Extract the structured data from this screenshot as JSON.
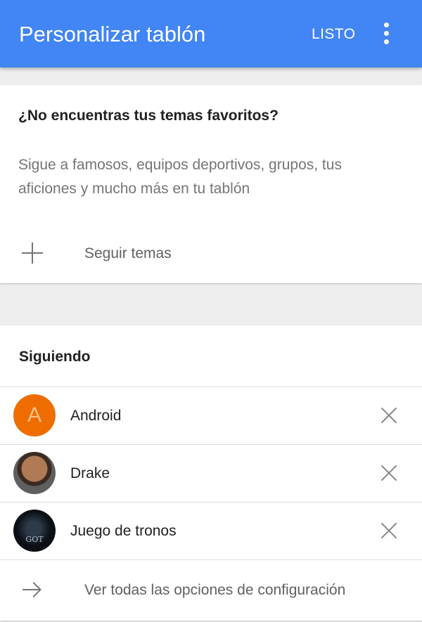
{
  "app_bar": {
    "title": "Personalizar tablón",
    "action_label": "LISTO",
    "background": "#4285f4",
    "overflow_icon": "more-vert-icon"
  },
  "discover_card": {
    "heading": "¿No encuentras tus temas favoritos?",
    "description": "Sigue a famosos, equipos deportivos, grupos, tus aficiones y mucho más en tu tablón",
    "follow_action": {
      "icon": "plus-icon",
      "label": "Seguir temas"
    }
  },
  "following": {
    "title": "Siguiendo",
    "items": [
      {
        "label": "Android",
        "avatar_letter": "A",
        "avatar_color": "#ef6c00",
        "remove_icon": "close-icon"
      },
      {
        "label": "Drake",
        "avatar": "photo",
        "remove_icon": "close-icon"
      },
      {
        "label": "Juego de tronos",
        "avatar": "photo",
        "avatar_text": "GOT",
        "remove_icon": "close-icon"
      }
    ],
    "settings_link": {
      "icon": "arrow-right-icon",
      "label": "Ver todas las opciones de configuración"
    }
  }
}
